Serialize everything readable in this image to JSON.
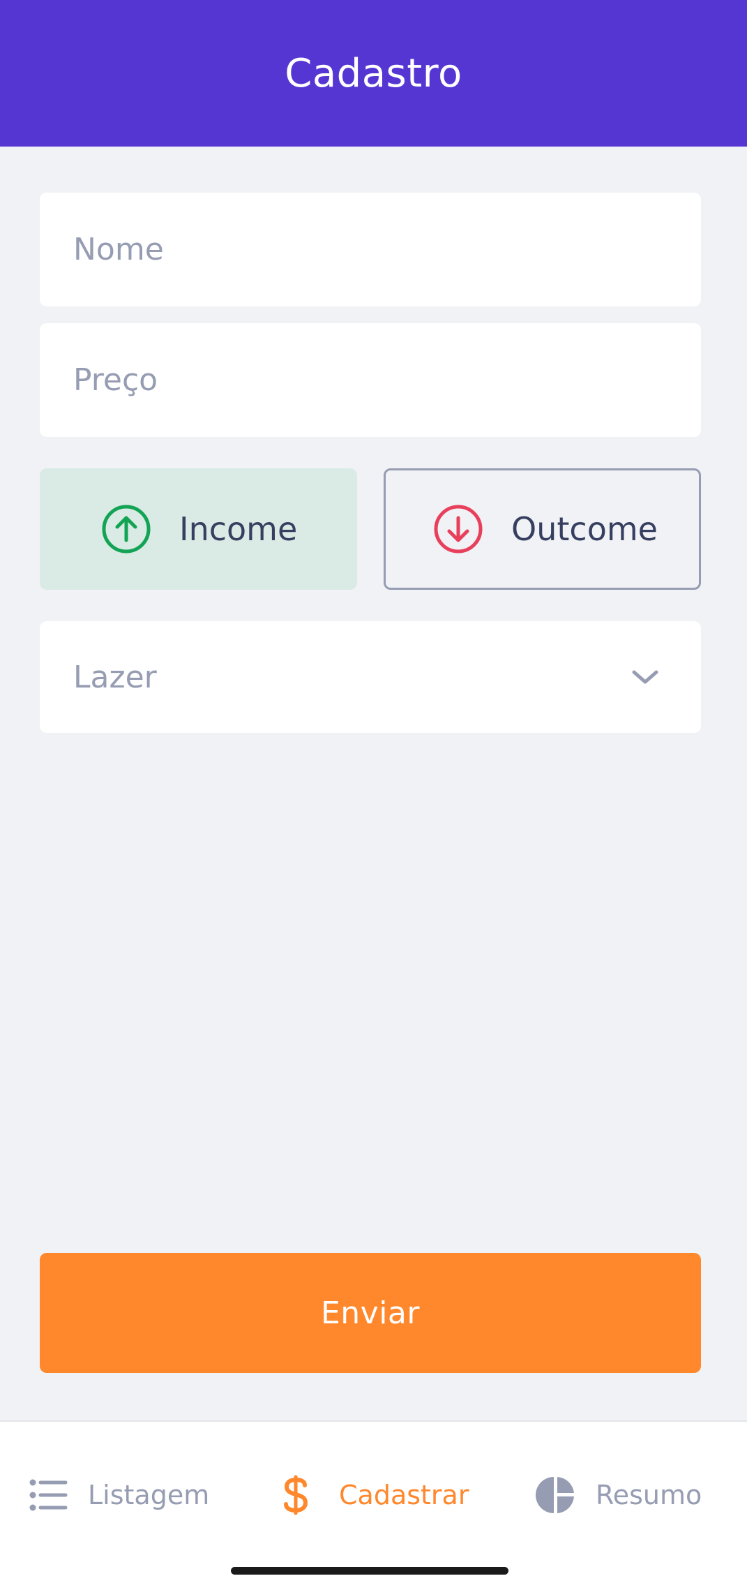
{
  "header": {
    "title": "Cadastro"
  },
  "form": {
    "name_placeholder": "Nome",
    "price_placeholder": "Preço",
    "income_label": "Income",
    "outcome_label": "Outcome",
    "category_value": "Lazer",
    "submit_label": "Enviar"
  },
  "tabs": [
    {
      "label": "Listagem",
      "icon": "list-icon",
      "active": false
    },
    {
      "label": "Cadastrar",
      "icon": "dollar-icon",
      "active": true
    },
    {
      "label": "Resumo",
      "icon": "pie-chart-icon",
      "active": false
    }
  ],
  "colors": {
    "primary": "#5636D3",
    "accent": "#FF872C",
    "success": "#12A454",
    "attention": "#E83F5B",
    "background": "#F0F2F5",
    "text": "#363F5F",
    "text_light": "#969CB2",
    "income_selected_bg": "#DAEAE4"
  }
}
